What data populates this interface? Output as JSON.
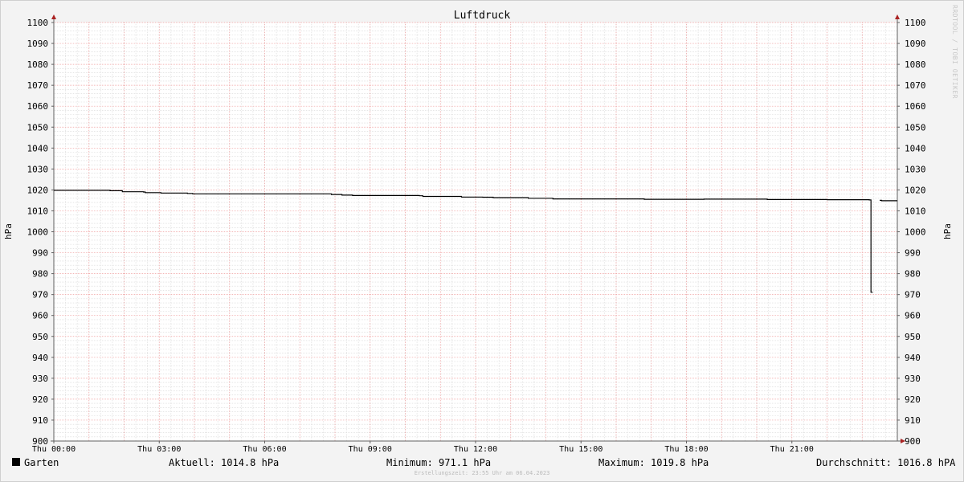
{
  "chart_data": {
    "type": "line",
    "title": "Luftdruck",
    "ylabel_left": "hPa",
    "ylabel_right": "hPa",
    "ylim": [
      900,
      1100
    ],
    "yticks": [
      900,
      910,
      920,
      930,
      940,
      950,
      960,
      970,
      980,
      990,
      1000,
      1010,
      1020,
      1030,
      1040,
      1050,
      1060,
      1070,
      1080,
      1090,
      1100
    ],
    "xlim": [
      0,
      24
    ],
    "xticks": [
      {
        "h": 0,
        "label": "Thu 00:00"
      },
      {
        "h": 3,
        "label": "Thu 03:00"
      },
      {
        "h": 6,
        "label": "Thu 06:00"
      },
      {
        "h": 9,
        "label": "Thu 09:00"
      },
      {
        "h": 12,
        "label": "Thu 12:00"
      },
      {
        "h": 15,
        "label": "Thu 15:00"
      },
      {
        "h": 18,
        "label": "Thu 18:00"
      },
      {
        "h": 21,
        "label": "Thu 21:00"
      }
    ],
    "grid": true,
    "series": [
      {
        "name": "Garten",
        "color": "#000000",
        "x": [
          0.0,
          1.6,
          1.95,
          2.55,
          2.6,
          3.05,
          3.8,
          3.95,
          7.9,
          8.2,
          8.5,
          10.4,
          10.5,
          11.5,
          11.6,
          12.2,
          12.5,
          13.5,
          14.2,
          16.8,
          18.5,
          20.3,
          22.0,
          23.2,
          23.25,
          23.3,
          23.4,
          23.5,
          23.55,
          24.0
        ],
        "y": [
          1019.8,
          1019.6,
          1019.1,
          1019.0,
          1018.7,
          1018.5,
          1018.3,
          1018.1,
          1017.8,
          1017.5,
          1017.3,
          1017.2,
          1016.9,
          1016.9,
          1016.6,
          1016.5,
          1016.3,
          1016.0,
          1015.7,
          1015.5,
          1015.6,
          1015.4,
          1015.3,
          1015.2,
          971.1,
          971.1,
          null,
          1015.0,
          1014.8,
          1014.8
        ]
      }
    ]
  },
  "legend": {
    "series_name": "Garten",
    "aktuell": "Aktuell: 1014.8 hPa",
    "minimum": "Minimum: 971.1 hPa",
    "maximum": "Maximum: 1019.8 hPa",
    "durchschnitt": "Durchschnitt: 1016.8 hPA"
  },
  "watermark": "RRDTOOL / TOBI OETIKER",
  "footer": "Erstellungszeit: 23:55 Uhr am 06.04.2023",
  "colors": {
    "major_grid": "#f0a0a0",
    "minor_grid": "#d8d8d8",
    "axis": "#606060",
    "arrow": "#aa2222",
    "plot_bg": "#ffffff"
  }
}
